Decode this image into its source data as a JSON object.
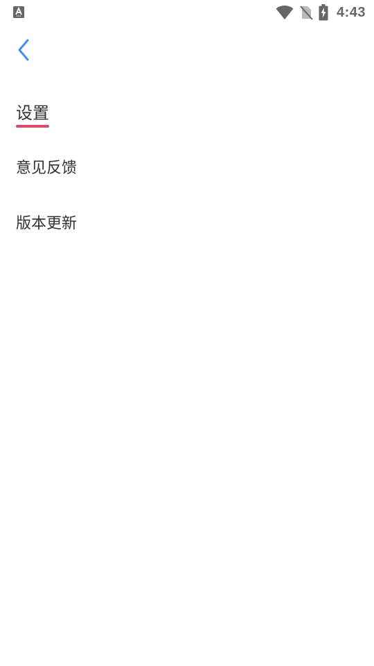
{
  "status_bar": {
    "left_icon": "a-notification-icon",
    "icons": [
      "wifi-icon",
      "no-sim-icon",
      "battery-charging-icon"
    ],
    "time": "4:43"
  },
  "header": {
    "back_icon": "chevron-left-icon",
    "back_color": "#3d8ff2"
  },
  "page": {
    "title": "设置",
    "accent_color": "#e2486a"
  },
  "menu": {
    "items": [
      {
        "label": "意见反馈"
      },
      {
        "label": "版本更新"
      }
    ]
  }
}
